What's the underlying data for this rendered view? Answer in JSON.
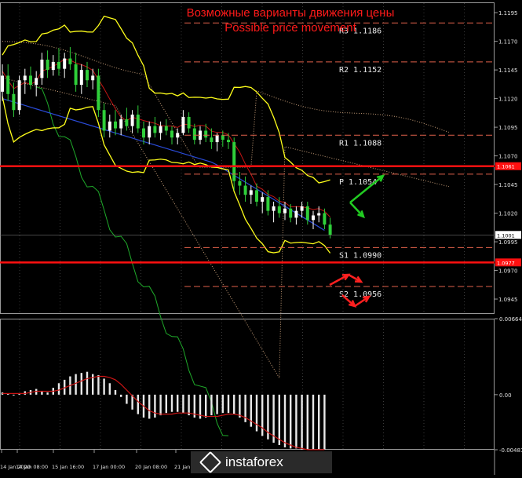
{
  "header": {
    "title_ru": "Возможные варианты движения цены",
    "title_en": "Possible price movement",
    "color": "#ff1a1a"
  },
  "chart_data": {
    "type": "candlestick",
    "instrument": "EURUSD",
    "price_axis": {
      "ylim": [
        1.0932,
        1.1204
      ],
      "ticks": [
        "1.1195",
        "1.1170",
        "1.1145",
        "1.1120",
        "1.1095",
        "1.1070",
        "1.1045",
        "1.1020",
        "1.0995",
        "1.0970",
        "1.0945"
      ],
      "current_price": "1.1001",
      "current_price_value": 1.1001
    },
    "time_axis": {
      "labels": [
        "14 Jan 2020",
        "14 Jan 08:00",
        "15 Jan 16:00",
        "17 Jan 00:00",
        "20 Jan 08:00",
        "21 Jan"
      ]
    },
    "levels": [
      {
        "name": "R3",
        "label": "R3 1.1186",
        "value": 1.1186,
        "color": "#e0604a"
      },
      {
        "name": "R2",
        "label": "R2 1.1152",
        "value": 1.1152,
        "color": "#e0604a"
      },
      {
        "name": "R1",
        "label": "R1 1.1088",
        "value": 1.1088,
        "color": "#e0604a"
      },
      {
        "name": "P",
        "label": "P 1.1054",
        "value": 1.1054,
        "color": "#e0604a"
      },
      {
        "name": "S1",
        "label": "S1 1.0990",
        "value": 1.099,
        "color": "#e0604a"
      },
      {
        "name": "S2",
        "label": "S2 1.0956",
        "value": 1.0956,
        "color": "#e0604a"
      }
    ],
    "horizontal_lines": [
      {
        "label": "1.1061",
        "value": 1.1061,
        "color": "#ff1010"
      },
      {
        "label": "1.0977",
        "value": 1.0977,
        "color": "#ff1010"
      }
    ],
    "candles": [
      [
        1.1126,
        1.115,
        1.1118,
        1.114
      ],
      [
        1.114,
        1.115,
        1.1118,
        1.1124
      ],
      [
        1.1124,
        1.1134,
        1.1104,
        1.111
      ],
      [
        1.111,
        1.114,
        1.1106,
        1.1136
      ],
      [
        1.1136,
        1.1146,
        1.1124,
        1.114
      ],
      [
        1.114,
        1.1148,
        1.1128,
        1.1132
      ],
      [
        1.1132,
        1.1144,
        1.1122,
        1.1138
      ],
      [
        1.1138,
        1.116,
        1.1132,
        1.1154
      ],
      [
        1.1154,
        1.1162,
        1.1138,
        1.1145
      ],
      [
        1.1145,
        1.1158,
        1.114,
        1.1152
      ],
      [
        1.1152,
        1.1164,
        1.114,
        1.1146
      ],
      [
        1.1146,
        1.116,
        1.1138,
        1.1155
      ],
      [
        1.1155,
        1.1165,
        1.1145,
        1.115
      ],
      [
        1.115,
        1.116,
        1.1126,
        1.1132
      ],
      [
        1.1132,
        1.115,
        1.1124,
        1.1145
      ],
      [
        1.1145,
        1.1152,
        1.113,
        1.1136
      ],
      [
        1.1136,
        1.1146,
        1.1128,
        1.114
      ],
      [
        1.114,
        1.1146,
        1.1104,
        1.111
      ],
      [
        1.111,
        1.1116,
        1.1086,
        1.1092
      ],
      [
        1.1092,
        1.1106,
        1.1086,
        1.11
      ],
      [
        1.11,
        1.111,
        1.1088,
        1.1094
      ],
      [
        1.1094,
        1.1106,
        1.1088,
        1.1102
      ],
      [
        1.1102,
        1.1112,
        1.1092,
        1.1096
      ],
      [
        1.1096,
        1.111,
        1.109,
        1.1106
      ],
      [
        1.1106,
        1.1114,
        1.109,
        1.1094
      ],
      [
        1.1094,
        1.11,
        1.108,
        1.1086
      ],
      [
        1.1086,
        1.11,
        1.108,
        1.1096
      ],
      [
        1.1096,
        1.1104,
        1.1086,
        1.109
      ],
      [
        1.109,
        1.11,
        1.1084,
        1.1096
      ],
      [
        1.1096,
        1.1102,
        1.1088,
        1.1092
      ],
      [
        1.1092,
        1.1096,
        1.108,
        1.1086
      ],
      [
        1.1086,
        1.1094,
        1.108,
        1.109
      ],
      [
        1.109,
        1.111,
        1.1088,
        1.1104
      ],
      [
        1.1104,
        1.1108,
        1.109,
        1.1094
      ],
      [
        1.1094,
        1.1098,
        1.108,
        1.1084
      ],
      [
        1.1084,
        1.1096,
        1.108,
        1.1092
      ],
      [
        1.1092,
        1.1098,
        1.1082,
        1.1086
      ],
      [
        1.1086,
        1.1094,
        1.1076,
        1.1082
      ],
      [
        1.1082,
        1.109,
        1.1074,
        1.1088
      ],
      [
        1.1088,
        1.1092,
        1.1078,
        1.1084
      ],
      [
        1.1084,
        1.109,
        1.1076,
        1.1082
      ],
      [
        1.1082,
        1.1086,
        1.104,
        1.1048
      ],
      [
        1.1048,
        1.1056,
        1.1036,
        1.1044
      ],
      [
        1.1044,
        1.1052,
        1.103,
        1.1036
      ],
      [
        1.1036,
        1.1044,
        1.1028,
        1.104
      ],
      [
        1.104,
        1.1046,
        1.1026,
        1.103
      ],
      [
        1.103,
        1.1038,
        1.102,
        1.1034
      ],
      [
        1.1034,
        1.104,
        1.1018,
        1.1022
      ],
      [
        1.1022,
        1.103,
        1.1012,
        1.1026
      ],
      [
        1.1026,
        1.1034,
        1.1016,
        1.102
      ],
      [
        1.102,
        1.103,
        1.1014,
        1.1024
      ],
      [
        1.1024,
        1.1028,
        1.1012,
        1.1016
      ],
      [
        1.1016,
        1.1026,
        1.101,
        1.1022
      ],
      [
        1.1022,
        1.103,
        1.1016,
        1.1026
      ],
      [
        1.1026,
        1.103,
        1.101,
        1.1014
      ],
      [
        1.1014,
        1.1022,
        1.1006,
        1.1018
      ],
      [
        1.1018,
        1.1026,
        1.1012,
        1.102
      ],
      [
        1.102,
        1.1024,
        1.1006,
        1.101
      ],
      [
        1.101,
        1.1016,
        1.0998,
        1.1001
      ]
    ],
    "indicators": {
      "macd_axis": {
        "ticks": [
          "0.00664",
          "0.00",
          "-0.00481"
        ]
      },
      "macd_histogram": [
        0.0002,
        0.0001,
        0.0,
        0.0001,
        0.0003,
        0.0004,
        0.0005,
        0.0003,
        0.0002,
        0.0006,
        0.001,
        0.0013,
        0.0016,
        0.0018,
        0.0019,
        0.002,
        0.0018,
        0.0017,
        0.0014,
        0.001,
        0.0004,
        -0.0002,
        -0.0008,
        -0.0013,
        -0.0017,
        -0.002,
        -0.0021,
        -0.002,
        -0.0018,
        -0.0016,
        -0.0015,
        -0.0015,
        -0.0016,
        -0.0018,
        -0.002,
        -0.0021,
        -0.002,
        -0.0018,
        -0.0017,
        -0.0016,
        -0.0016,
        -0.0017,
        -0.002,
        -0.0024,
        -0.0028,
        -0.0032,
        -0.0036,
        -0.0039,
        -0.0042,
        -0.0044,
        -0.0046,
        -0.0047,
        -0.0047,
        -0.0048,
        -0.0048,
        -0.0048,
        -0.0048,
        -0.0048
      ],
      "macd_signal": [
        0.0001,
        0.0001,
        0.0001,
        0.0001,
        0.0001,
        0.0002,
        0.0003,
        0.0003,
        0.0003,
        0.0003,
        0.0004,
        0.0006,
        0.0008,
        0.001,
        0.0012,
        0.0014,
        0.0015,
        0.0016,
        0.0016,
        0.0015,
        0.0013,
        0.0009,
        0.0004,
        -0.0001,
        -0.0006,
        -0.001,
        -0.0014,
        -0.0016,
        -0.0017,
        -0.0017,
        -0.0017,
        -0.0016,
        -0.0016,
        -0.0016,
        -0.0017,
        -0.0018,
        -0.0019,
        -0.0019,
        -0.0019,
        -0.0018,
        -0.0017,
        -0.0017,
        -0.0018,
        -0.002,
        -0.0023,
        -0.0026,
        -0.0029,
        -0.0033,
        -0.0036,
        -0.0039,
        -0.0042,
        -0.0044,
        -0.0046,
        -0.0047,
        -0.0048,
        -0.0048,
        -0.0048,
        -0.0048
      ]
    }
  },
  "watermark": {
    "text": "instaforex"
  }
}
